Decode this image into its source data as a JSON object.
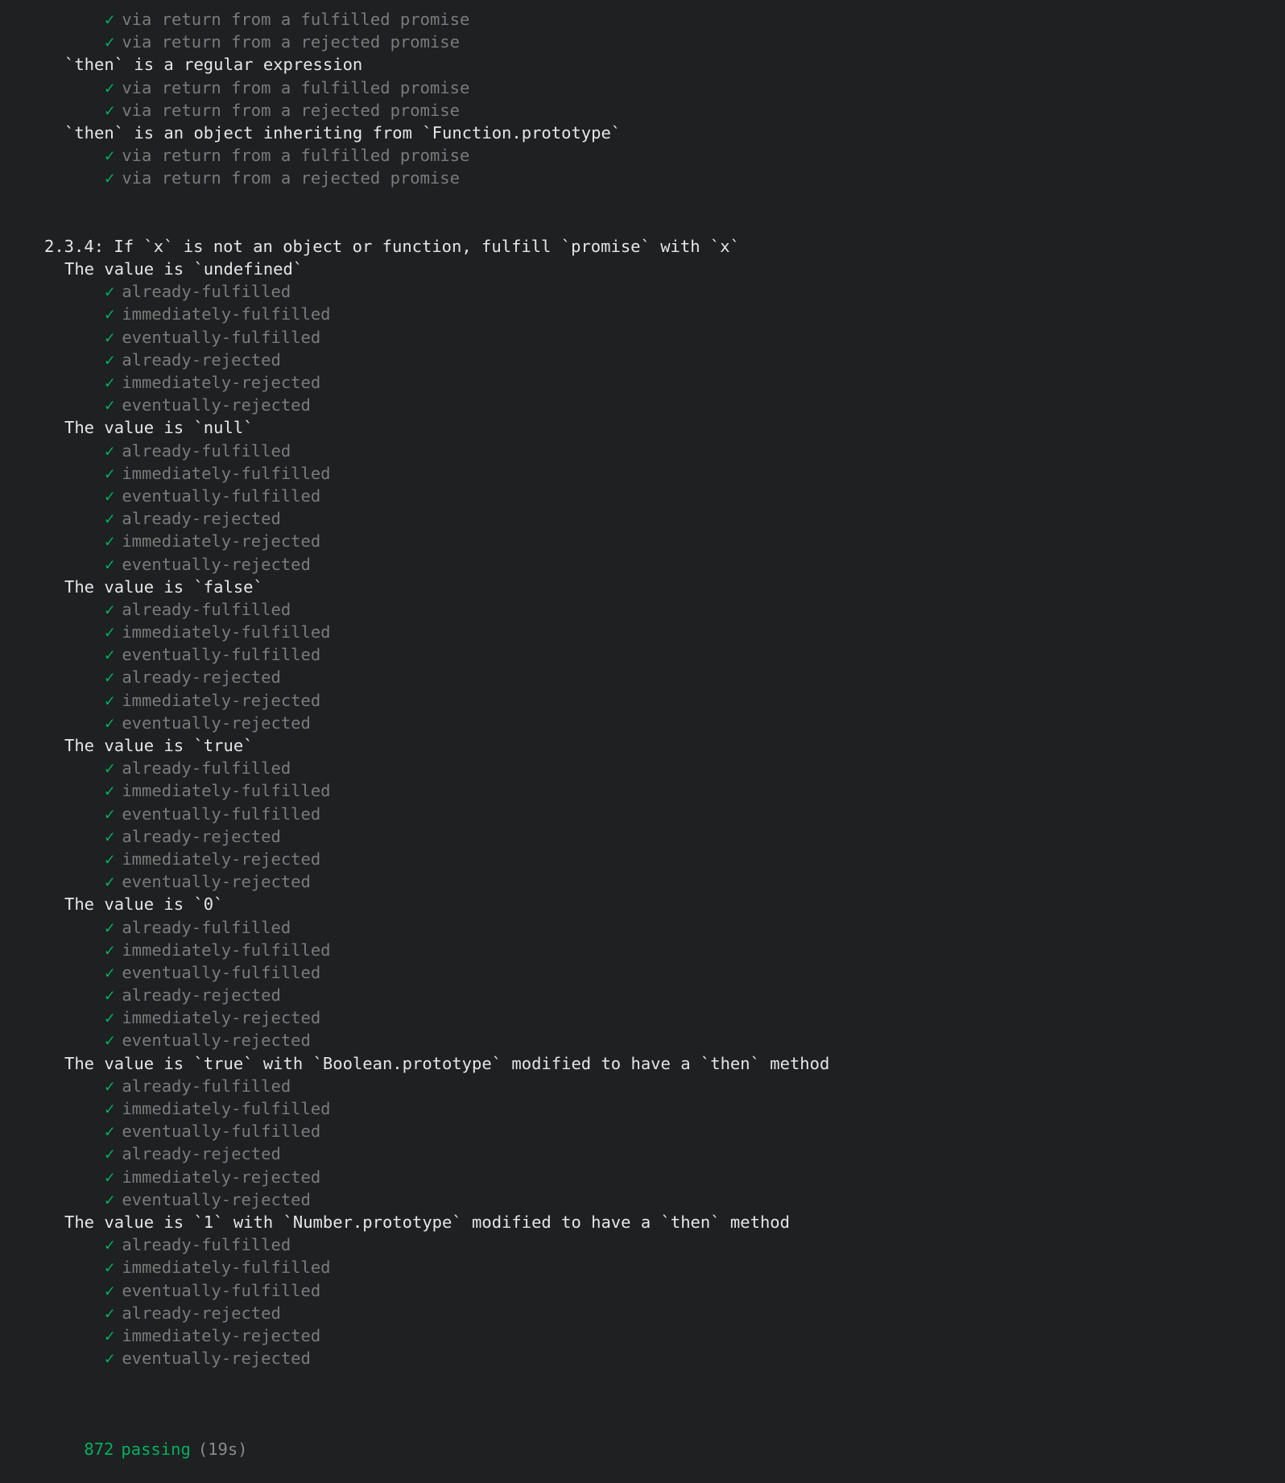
{
  "terminal": {
    "background_color": "#1e2021",
    "suite_title_color": "#e6e6e6",
    "test_pass_color": "#7b7b7b",
    "checkmark_color": "#00b061",
    "checkmark_glyph": "✓",
    "duration_color": "#8a8a8a"
  },
  "lines": [
    {
      "kind": "test",
      "indent": "ind-test3",
      "text": "via return from a fulfilled promise"
    },
    {
      "kind": "test",
      "indent": "ind-test3",
      "text": "via return from a rejected promise"
    },
    {
      "kind": "suite",
      "indent": "ind-suite2",
      "text": "`then` is a regular expression"
    },
    {
      "kind": "test",
      "indent": "ind-test3",
      "text": "via return from a fulfilled promise"
    },
    {
      "kind": "test",
      "indent": "ind-test3",
      "text": "via return from a rejected promise"
    },
    {
      "kind": "suite",
      "indent": "ind-suite2",
      "text": "`then` is an object inheriting from `Function.prototype`"
    },
    {
      "kind": "test",
      "indent": "ind-test3",
      "text": "via return from a fulfilled promise"
    },
    {
      "kind": "test",
      "indent": "ind-test3",
      "text": "via return from a rejected promise"
    },
    {
      "kind": "blank",
      "indent": "",
      "text": ""
    },
    {
      "kind": "blank",
      "indent": "",
      "text": ""
    },
    {
      "kind": "suite",
      "indent": "ind-suite1",
      "text": "2.3.4: If `x` is not an object or function, fulfill `promise` with `x`"
    },
    {
      "kind": "suite",
      "indent": "ind-suite2",
      "text": "The value is `undefined`"
    },
    {
      "kind": "test",
      "indent": "ind-test3",
      "text": "already-fulfilled"
    },
    {
      "kind": "test",
      "indent": "ind-test3",
      "text": "immediately-fulfilled"
    },
    {
      "kind": "test",
      "indent": "ind-test3",
      "text": "eventually-fulfilled"
    },
    {
      "kind": "test",
      "indent": "ind-test3",
      "text": "already-rejected"
    },
    {
      "kind": "test",
      "indent": "ind-test3",
      "text": "immediately-rejected"
    },
    {
      "kind": "test",
      "indent": "ind-test3",
      "text": "eventually-rejected"
    },
    {
      "kind": "suite",
      "indent": "ind-suite2",
      "text": "The value is `null`"
    },
    {
      "kind": "test",
      "indent": "ind-test3",
      "text": "already-fulfilled"
    },
    {
      "kind": "test",
      "indent": "ind-test3",
      "text": "immediately-fulfilled"
    },
    {
      "kind": "test",
      "indent": "ind-test3",
      "text": "eventually-fulfilled"
    },
    {
      "kind": "test",
      "indent": "ind-test3",
      "text": "already-rejected"
    },
    {
      "kind": "test",
      "indent": "ind-test3",
      "text": "immediately-rejected"
    },
    {
      "kind": "test",
      "indent": "ind-test3",
      "text": "eventually-rejected"
    },
    {
      "kind": "suite",
      "indent": "ind-suite2",
      "text": "The value is `false`"
    },
    {
      "kind": "test",
      "indent": "ind-test3",
      "text": "already-fulfilled"
    },
    {
      "kind": "test",
      "indent": "ind-test3",
      "text": "immediately-fulfilled"
    },
    {
      "kind": "test",
      "indent": "ind-test3",
      "text": "eventually-fulfilled"
    },
    {
      "kind": "test",
      "indent": "ind-test3",
      "text": "already-rejected"
    },
    {
      "kind": "test",
      "indent": "ind-test3",
      "text": "immediately-rejected"
    },
    {
      "kind": "test",
      "indent": "ind-test3",
      "text": "eventually-rejected"
    },
    {
      "kind": "suite",
      "indent": "ind-suite2",
      "text": "The value is `true`"
    },
    {
      "kind": "test",
      "indent": "ind-test3",
      "text": "already-fulfilled"
    },
    {
      "kind": "test",
      "indent": "ind-test3",
      "text": "immediately-fulfilled"
    },
    {
      "kind": "test",
      "indent": "ind-test3",
      "text": "eventually-fulfilled"
    },
    {
      "kind": "test",
      "indent": "ind-test3",
      "text": "already-rejected"
    },
    {
      "kind": "test",
      "indent": "ind-test3",
      "text": "immediately-rejected"
    },
    {
      "kind": "test",
      "indent": "ind-test3",
      "text": "eventually-rejected"
    },
    {
      "kind": "suite",
      "indent": "ind-suite2",
      "text": "The value is `0`"
    },
    {
      "kind": "test",
      "indent": "ind-test3",
      "text": "already-fulfilled"
    },
    {
      "kind": "test",
      "indent": "ind-test3",
      "text": "immediately-fulfilled"
    },
    {
      "kind": "test",
      "indent": "ind-test3",
      "text": "eventually-fulfilled"
    },
    {
      "kind": "test",
      "indent": "ind-test3",
      "text": "already-rejected"
    },
    {
      "kind": "test",
      "indent": "ind-test3",
      "text": "immediately-rejected"
    },
    {
      "kind": "test",
      "indent": "ind-test3",
      "text": "eventually-rejected"
    },
    {
      "kind": "suite",
      "indent": "ind-suite2",
      "text": "The value is `true` with `Boolean.prototype` modified to have a `then` method"
    },
    {
      "kind": "test",
      "indent": "ind-test3",
      "text": "already-fulfilled"
    },
    {
      "kind": "test",
      "indent": "ind-test3",
      "text": "immediately-fulfilled"
    },
    {
      "kind": "test",
      "indent": "ind-test3",
      "text": "eventually-fulfilled"
    },
    {
      "kind": "test",
      "indent": "ind-test3",
      "text": "already-rejected"
    },
    {
      "kind": "test",
      "indent": "ind-test3",
      "text": "immediately-rejected"
    },
    {
      "kind": "test",
      "indent": "ind-test3",
      "text": "eventually-rejected"
    },
    {
      "kind": "suite",
      "indent": "ind-suite2",
      "text": "The value is `1` with `Number.prototype` modified to have a `then` method"
    },
    {
      "kind": "test",
      "indent": "ind-test3",
      "text": "already-fulfilled"
    },
    {
      "kind": "test",
      "indent": "ind-test3",
      "text": "immediately-fulfilled"
    },
    {
      "kind": "test",
      "indent": "ind-test3",
      "text": "eventually-fulfilled"
    },
    {
      "kind": "test",
      "indent": "ind-test3",
      "text": "already-rejected"
    },
    {
      "kind": "test",
      "indent": "ind-test3",
      "text": "immediately-rejected"
    },
    {
      "kind": "test",
      "indent": "ind-test3",
      "text": "eventually-rejected"
    },
    {
      "kind": "blank",
      "indent": "",
      "text": ""
    },
    {
      "kind": "blank",
      "indent": "",
      "text": ""
    }
  ],
  "summary": {
    "passing_count": "872",
    "passing_label": "passing",
    "duration": "(19s)"
  }
}
